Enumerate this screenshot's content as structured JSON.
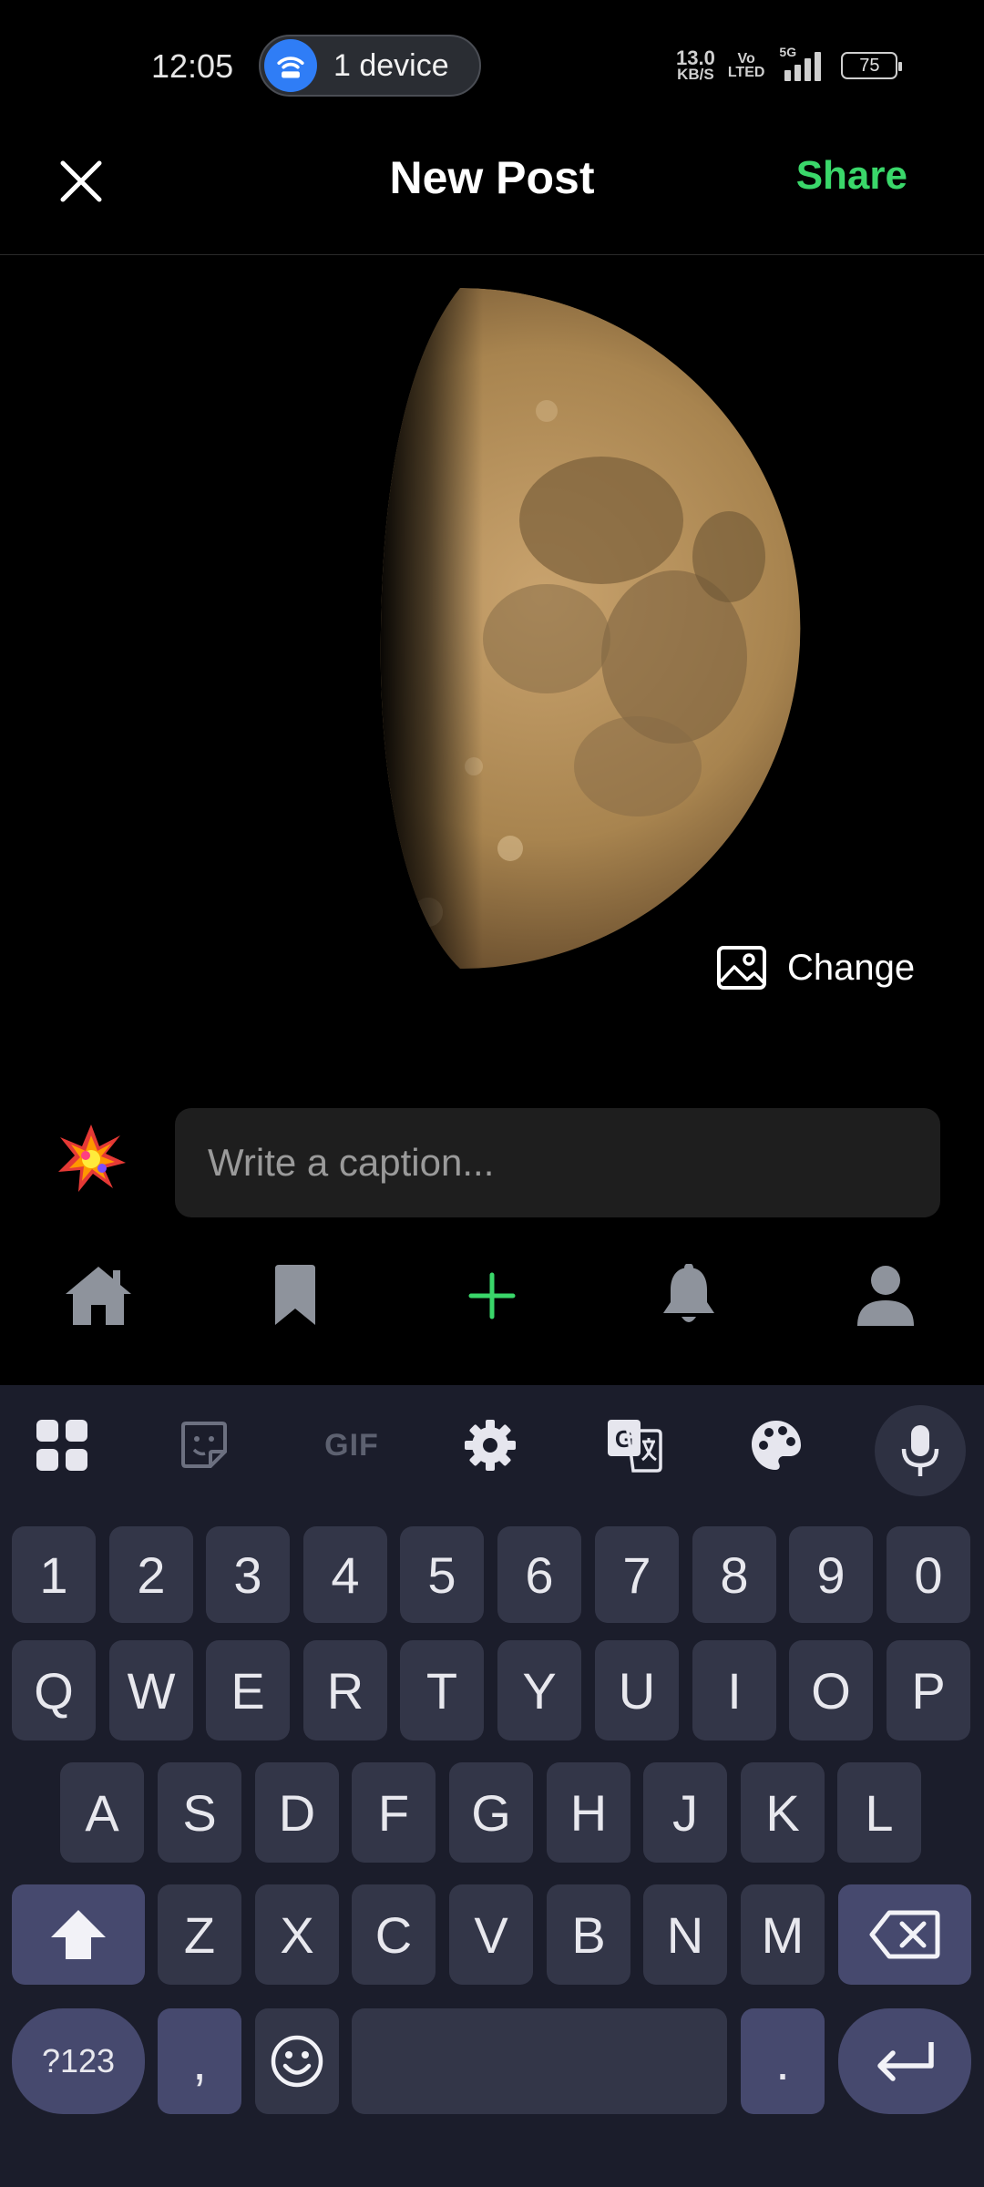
{
  "status_bar": {
    "time": "12:05",
    "hotspot_label": "1 device",
    "net_speed_value": "13.0",
    "net_speed_unit": "KB/S",
    "volte_top": "Vo",
    "volte_bottom": "LTED",
    "network_type": "5G",
    "battery_level": "75"
  },
  "header": {
    "title": "New Post",
    "share_label": "Share",
    "accent_color": "#3ad76a"
  },
  "photo": {
    "change_label": "Change"
  },
  "caption": {
    "placeholder": "Write a caption..."
  },
  "bottom_nav": {
    "items": [
      "home-icon",
      "bookmark-icon",
      "plus-icon",
      "bell-icon",
      "user-icon"
    ],
    "active": "plus-icon"
  },
  "keyboard": {
    "toolbar": {
      "gif_label": "GIF",
      "items": [
        "apps-grid-icon",
        "sticker-icon",
        "gif-icon",
        "settings-gear-icon",
        "translate-icon",
        "palette-icon",
        "mic-icon"
      ]
    },
    "rows": {
      "numbers": [
        "1",
        "2",
        "3",
        "4",
        "5",
        "6",
        "7",
        "8",
        "9",
        "0"
      ],
      "row1": [
        "Q",
        "W",
        "E",
        "R",
        "T",
        "Y",
        "U",
        "I",
        "O",
        "P"
      ],
      "row2": [
        "A",
        "S",
        "D",
        "F",
        "G",
        "H",
        "J",
        "K",
        "L"
      ],
      "row3": [
        "Z",
        "X",
        "C",
        "V",
        "B",
        "N",
        "M"
      ]
    },
    "symbols_label": "?123",
    "comma": ",",
    "period": "."
  }
}
